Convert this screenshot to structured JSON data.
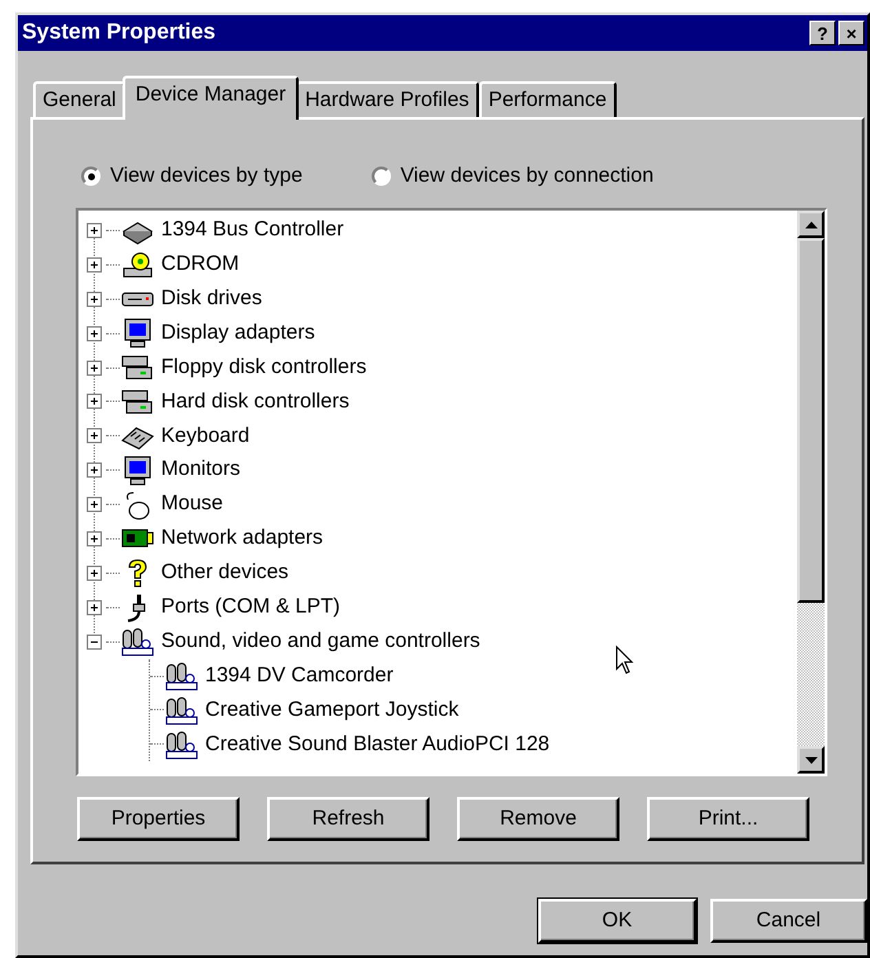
{
  "window": {
    "title": "System Properties",
    "title_buttons": [
      "?",
      "×"
    ]
  },
  "tabs": [
    {
      "label": "General",
      "selected": false
    },
    {
      "label": "Device Manager",
      "selected": true
    },
    {
      "label": "Hardware Profiles",
      "selected": false
    },
    {
      "label": "Performance",
      "selected": false
    }
  ],
  "view_options": [
    {
      "label": "View devices by type",
      "selected": true
    },
    {
      "label": "View devices by connection",
      "selected": false
    }
  ],
  "device_tree": [
    {
      "label": "1394 Bus Controller",
      "kind": "bus",
      "expanded": false
    },
    {
      "label": "CDROM",
      "kind": "cdrom",
      "expanded": false
    },
    {
      "label": "Disk drives",
      "kind": "disk",
      "expanded": false
    },
    {
      "label": "Display adapters",
      "kind": "monitor",
      "expanded": false
    },
    {
      "label": "Floppy disk controllers",
      "kind": "controller",
      "expanded": false
    },
    {
      "label": "Hard disk controllers",
      "kind": "controller",
      "expanded": false
    },
    {
      "label": "Keyboard",
      "kind": "keyboard",
      "expanded": false
    },
    {
      "label": "Monitors",
      "kind": "monitor",
      "expanded": false
    },
    {
      "label": "Mouse",
      "kind": "mouse",
      "expanded": false
    },
    {
      "label": "Network adapters",
      "kind": "network",
      "expanded": false
    },
    {
      "label": "Other devices",
      "kind": "unknown",
      "expanded": false
    },
    {
      "label": "Ports (COM & LPT)",
      "kind": "port",
      "expanded": false
    },
    {
      "label": "Sound, video and game controllers",
      "kind": "multimedia",
      "expanded": true,
      "children": [
        {
          "label": "1394 DV Camcorder",
          "kind": "multimedia"
        },
        {
          "label": "Creative Gameport Joystick",
          "kind": "multimedia"
        },
        {
          "label": "Creative Sound Blaster AudioPCI 128",
          "kind": "multimedia"
        }
      ]
    }
  ],
  "action_buttons": [
    "Properties",
    "Refresh",
    "Remove",
    "Print..."
  ],
  "dialog_buttons": [
    {
      "label": "OK",
      "default": true
    },
    {
      "label": "Cancel",
      "default": false
    }
  ]
}
